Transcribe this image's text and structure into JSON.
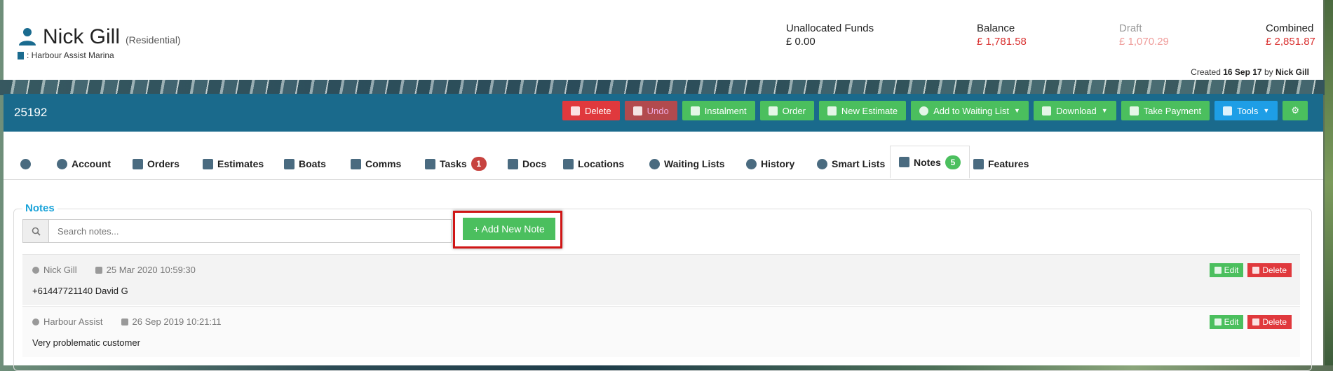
{
  "client": {
    "name": "Nick Gill",
    "type": "(Residential)",
    "marina": ": Harbour Assist Marina"
  },
  "funds": {
    "unallocated_label": "Unallocated Funds",
    "unallocated_value": "£ 0.00",
    "balance_label": "Balance",
    "balance_value": "£ 1,781.58",
    "draft_label": "Draft",
    "draft_value": "£ 1,070.29",
    "combined_label": "Combined",
    "combined_value": "£ 2,851.87"
  },
  "created": {
    "prefix": "Created",
    "date": "16 Sep 17",
    "by": "by",
    "user": "Nick Gill"
  },
  "toolbar": {
    "ref": "25192",
    "buttons": {
      "delete": "Delete",
      "undo": "Undo",
      "instalment": "Instalment",
      "order": "Order",
      "new_estimate": "New Estimate",
      "waiting_list": "Add to Waiting List",
      "download": "Download",
      "take_payment": "Take Payment",
      "tools": "Tools"
    }
  },
  "tabs": {
    "account": "Account",
    "orders": "Orders",
    "estimates": "Estimates",
    "boats": "Boats",
    "comms": "Comms",
    "tasks": "Tasks",
    "tasks_badge": "1",
    "docs": "Docs",
    "locations": "Locations",
    "waiting_lists": "Waiting Lists",
    "history": "History",
    "smart_lists": "Smart Lists",
    "notes": "Notes",
    "notes_badge": "5",
    "features": "Features"
  },
  "notes_panel": {
    "title": "Notes",
    "search_placeholder": "Search notes...",
    "add_button": "+ Add New Note",
    "items": [
      {
        "author": "Nick Gill",
        "date": "25 Mar 2020 10:59:30",
        "text": "+61447721140 David G"
      },
      {
        "author": "Harbour Assist",
        "date": "26 Sep 2019 10:21:11",
        "text": "Very problematic customer"
      }
    ],
    "edit_label": "Edit",
    "delete_label": "Delete"
  },
  "colors": {
    "toolbar_bg": "#1a6a8c",
    "danger": "#e0393d",
    "success": "#4bbf5e",
    "info": "#1e9ee6",
    "accent_title": "#1aa3d9"
  }
}
